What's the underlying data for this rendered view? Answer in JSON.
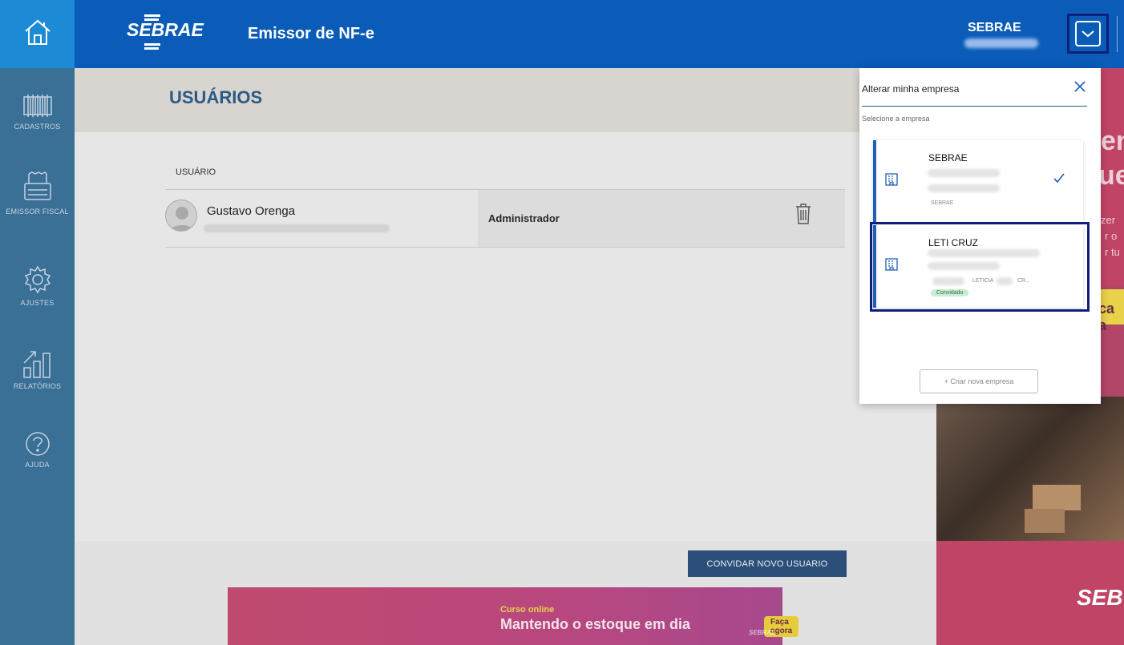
{
  "header": {
    "logo_text": "SEBRAE",
    "app_title": "Emissor de NF-e",
    "company_name": "SEBRAE"
  },
  "sidebar": {
    "items": [
      {
        "label": "CADASTROS",
        "icon": "barcode-icon"
      },
      {
        "label": "EMISSOR FISCAL",
        "icon": "printer-icon"
      },
      {
        "label": "AJUSTES",
        "icon": "gear-icon"
      },
      {
        "label": "RELATÓRIOS",
        "icon": "chart-icon"
      },
      {
        "label": "AJUDA",
        "icon": "help-icon"
      }
    ]
  },
  "main": {
    "title": "USUÁRIOS",
    "column_header": "USUÁRIO",
    "users": [
      {
        "name": "Gustavo Orenga",
        "role": "Administrador"
      }
    ],
    "invite_button": "CONVIDAR NOVO USUARIO"
  },
  "banner": {
    "small": "Curso online",
    "big": "Mantendo o estoque em dia",
    "cta": "Faça agora",
    "logo": "SEBRAE"
  },
  "promo": {
    "lines": [
      "en",
      "ue",
      "zer",
      "r o",
      "r tu",
      "ca a"
    ],
    "logo": "SEB"
  },
  "panel": {
    "title": "Alterar minha empresa",
    "subtitle": "Selecione a empresa",
    "companies": [
      {
        "name": "SEBRAE",
        "small": "SEBRAE",
        "selected": true
      },
      {
        "name": "LETI CRUZ",
        "small_a": "LETICIA",
        "small_b": "CR...",
        "badge": "Convidado"
      }
    ],
    "create_button": "+ Criar nova empresa"
  },
  "colors": {
    "topbar": "#0a5cb8",
    "accent": "#1f5fb5",
    "sidebar": "#3a6f96",
    "badge_bg": "#c9ecd3"
  }
}
